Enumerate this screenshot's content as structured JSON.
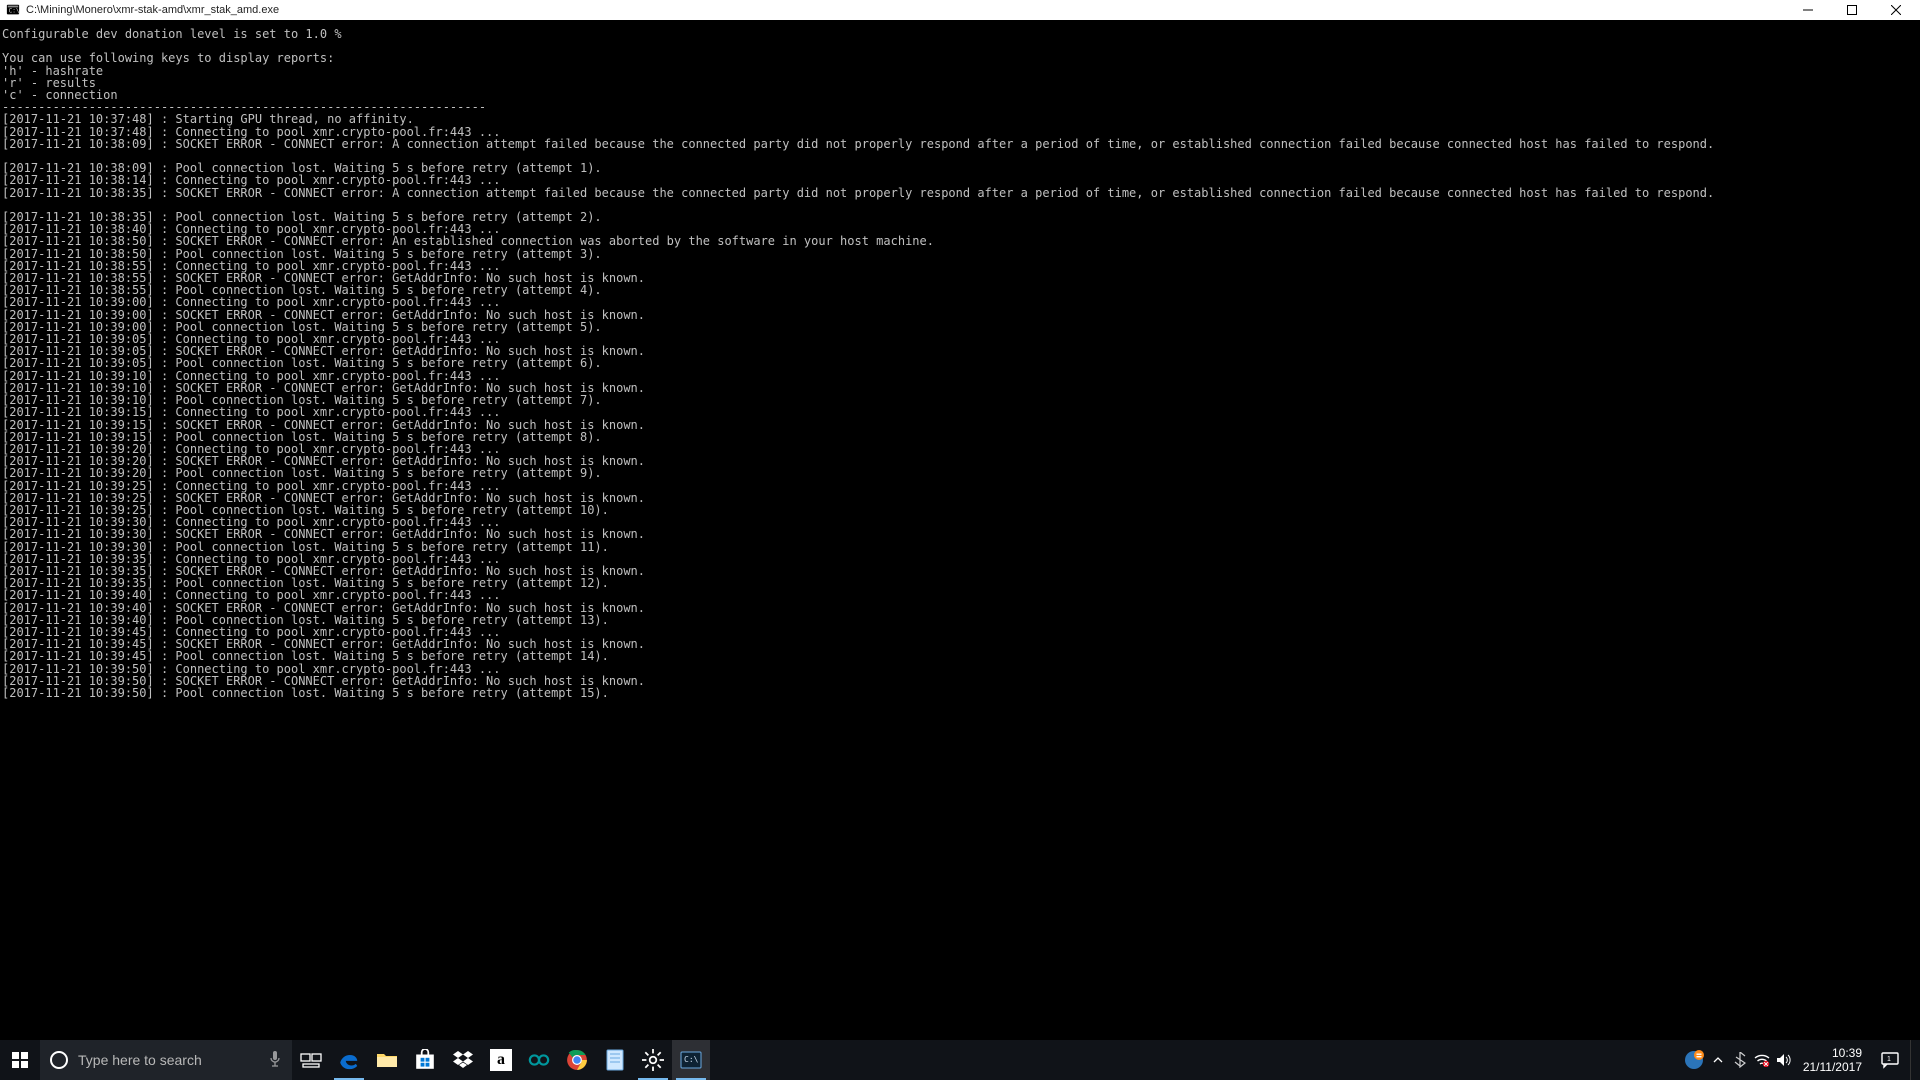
{
  "window": {
    "title": "C:\\Mining\\Monero\\xmr-stak-amd\\xmr_stak_amd.exe"
  },
  "terminal": {
    "intro": [
      "Configurable dev donation level is set to 1.0 %",
      "",
      "You can use following keys to display reports:",
      "'h' - hashrate",
      "'r' - results",
      "'c' - connection",
      "-------------------------------------------------------------------"
    ],
    "log": [
      "[2017-11-21 10:37:48] : Starting GPU thread, no affinity.",
      "[2017-11-21 10:37:48] : Connecting to pool xmr.crypto-pool.fr:443 ...",
      "[2017-11-21 10:38:09] : SOCKET ERROR - CONNECT error: A connection attempt failed because the connected party did not properly respond after a period of time, or established connection failed because connected host has failed to respond.",
      "",
      "[2017-11-21 10:38:09] : Pool connection lost. Waiting 5 s before retry (attempt 1).",
      "[2017-11-21 10:38:14] : Connecting to pool xmr.crypto-pool.fr:443 ...",
      "[2017-11-21 10:38:35] : SOCKET ERROR - CONNECT error: A connection attempt failed because the connected party did not properly respond after a period of time, or established connection failed because connected host has failed to respond.",
      "",
      "[2017-11-21 10:38:35] : Pool connection lost. Waiting 5 s before retry (attempt 2).",
      "[2017-11-21 10:38:40] : Connecting to pool xmr.crypto-pool.fr:443 ...",
      "[2017-11-21 10:38:50] : SOCKET ERROR - CONNECT error: An established connection was aborted by the software in your host machine.",
      "[2017-11-21 10:38:50] : Pool connection lost. Waiting 5 s before retry (attempt 3).",
      "[2017-11-21 10:38:55] : Connecting to pool xmr.crypto-pool.fr:443 ...",
      "[2017-11-21 10:38:55] : SOCKET ERROR - CONNECT error: GetAddrInfo: No such host is known.",
      "[2017-11-21 10:38:55] : Pool connection lost. Waiting 5 s before retry (attempt 4).",
      "[2017-11-21 10:39:00] : Connecting to pool xmr.crypto-pool.fr:443 ...",
      "[2017-11-21 10:39:00] : SOCKET ERROR - CONNECT error: GetAddrInfo: No such host is known.",
      "[2017-11-21 10:39:00] : Pool connection lost. Waiting 5 s before retry (attempt 5).",
      "[2017-11-21 10:39:05] : Connecting to pool xmr.crypto-pool.fr:443 ...",
      "[2017-11-21 10:39:05] : SOCKET ERROR - CONNECT error: GetAddrInfo: No such host is known.",
      "[2017-11-21 10:39:05] : Pool connection lost. Waiting 5 s before retry (attempt 6).",
      "[2017-11-21 10:39:10] : Connecting to pool xmr.crypto-pool.fr:443 ...",
      "[2017-11-21 10:39:10] : SOCKET ERROR - CONNECT error: GetAddrInfo: No such host is known.",
      "[2017-11-21 10:39:10] : Pool connection lost. Waiting 5 s before retry (attempt 7).",
      "[2017-11-21 10:39:15] : Connecting to pool xmr.crypto-pool.fr:443 ...",
      "[2017-11-21 10:39:15] : SOCKET ERROR - CONNECT error: GetAddrInfo: No such host is known.",
      "[2017-11-21 10:39:15] : Pool connection lost. Waiting 5 s before retry (attempt 8).",
      "[2017-11-21 10:39:20] : Connecting to pool xmr.crypto-pool.fr:443 ...",
      "[2017-11-21 10:39:20] : SOCKET ERROR - CONNECT error: GetAddrInfo: No such host is known.",
      "[2017-11-21 10:39:20] : Pool connection lost. Waiting 5 s before retry (attempt 9).",
      "[2017-11-21 10:39:25] : Connecting to pool xmr.crypto-pool.fr:443 ...",
      "[2017-11-21 10:39:25] : SOCKET ERROR - CONNECT error: GetAddrInfo: No such host is known.",
      "[2017-11-21 10:39:25] : Pool connection lost. Waiting 5 s before retry (attempt 10).",
      "[2017-11-21 10:39:30] : Connecting to pool xmr.crypto-pool.fr:443 ...",
      "[2017-11-21 10:39:30] : SOCKET ERROR - CONNECT error: GetAddrInfo: No such host is known.",
      "[2017-11-21 10:39:30] : Pool connection lost. Waiting 5 s before retry (attempt 11).",
      "[2017-11-21 10:39:35] : Connecting to pool xmr.crypto-pool.fr:443 ...",
      "[2017-11-21 10:39:35] : SOCKET ERROR - CONNECT error: GetAddrInfo: No such host is known.",
      "[2017-11-21 10:39:35] : Pool connection lost. Waiting 5 s before retry (attempt 12).",
      "[2017-11-21 10:39:40] : Connecting to pool xmr.crypto-pool.fr:443 ...",
      "[2017-11-21 10:39:40] : SOCKET ERROR - CONNECT error: GetAddrInfo: No such host is known.",
      "[2017-11-21 10:39:40] : Pool connection lost. Waiting 5 s before retry (attempt 13).",
      "[2017-11-21 10:39:45] : Connecting to pool xmr.crypto-pool.fr:443 ...",
      "[2017-11-21 10:39:45] : SOCKET ERROR - CONNECT error: GetAddrInfo: No such host is known.",
      "[2017-11-21 10:39:45] : Pool connection lost. Waiting 5 s before retry (attempt 14).",
      "[2017-11-21 10:39:50] : Connecting to pool xmr.crypto-pool.fr:443 ...",
      "[2017-11-21 10:39:50] : SOCKET ERROR - CONNECT error: GetAddrInfo: No such host is known.",
      "[2017-11-21 10:39:50] : Pool connection lost. Waiting 5 s before retry (attempt 15)."
    ]
  },
  "taskbar": {
    "search_placeholder": "Type here to search",
    "time": "10:39",
    "date": "21/11/2017"
  }
}
